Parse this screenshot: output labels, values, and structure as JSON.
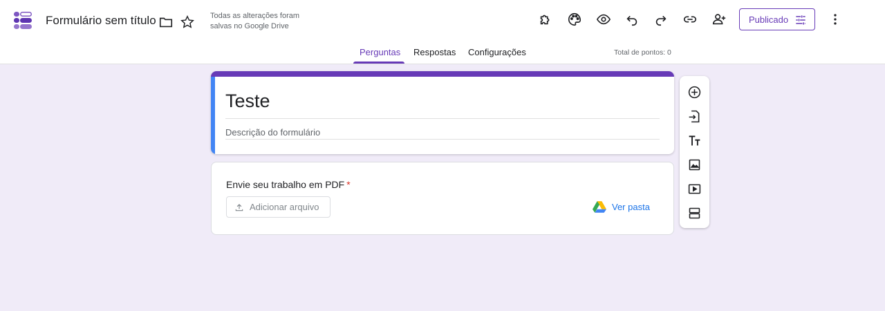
{
  "header": {
    "app_icon": "forms-logo-icon",
    "doc_title": "Formulário sem título",
    "save_status": "Todas as alterações foram salvas no Google Drive",
    "publish_label": "Publicado",
    "icons": [
      "folder-icon",
      "star-icon",
      "addons-icon",
      "palette-icon",
      "preview-icon",
      "undo-icon",
      "redo-icon",
      "link-icon",
      "add-collaborator-icon",
      "publish-settings-icon",
      "more-options-icon"
    ]
  },
  "tabs": [
    {
      "label": "Perguntas",
      "active": true
    },
    {
      "label": "Respostas",
      "active": false
    },
    {
      "label": "Configurações",
      "active": false
    }
  ],
  "points_label": "Total de pontos: 0",
  "form": {
    "title": "Teste",
    "description_placeholder": "Descrição do formulário"
  },
  "question": {
    "text": "Envie seu trabalho em PDF",
    "required_mark": "*",
    "upload_label": "Adicionar arquivo",
    "view_folder_label": "Ver pasta"
  },
  "side_toolbar": [
    "add-question-icon",
    "import-questions-icon",
    "add-title-icon",
    "add-image-icon",
    "add-video-icon",
    "add-section-icon"
  ],
  "colors": {
    "accent": "#673ab7",
    "background": "#f0ebf8",
    "title_side_bar": "#4285f4",
    "link": "#1a73e8",
    "required": "#d93025"
  }
}
